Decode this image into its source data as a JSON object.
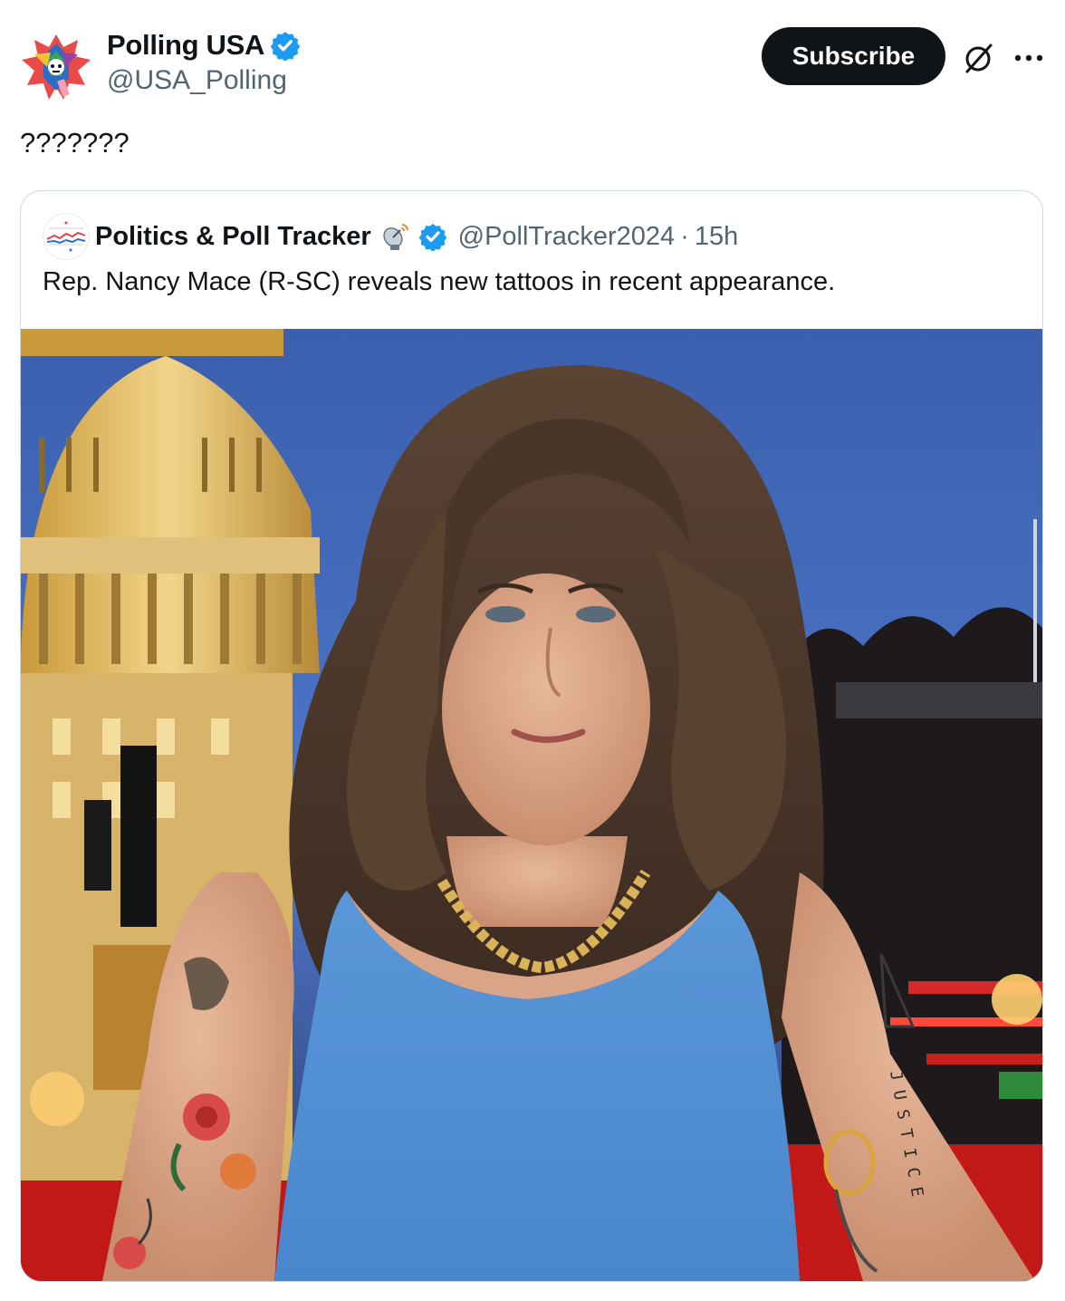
{
  "author": {
    "display_name": "Polling USA",
    "handle": "@USA_Polling",
    "avatar_icon": "polling-usa-logo-icon",
    "verified_icon": "verified-badge-icon"
  },
  "actions": {
    "subscribe_label": "Subscribe",
    "grok_icon": "grok-slash-icon",
    "more_icon": "more-dots-icon"
  },
  "post": {
    "text": "???????"
  },
  "quoted_post": {
    "display_name": "Politics & Poll Tracker",
    "name_emoji_icon": "satellite-antenna-icon",
    "handle": "@PollTracker2024",
    "separator": "·",
    "time": "15h",
    "text": "Rep. Nancy Mace (R-SC) reveals new tattoos in recent appearance.",
    "image": {
      "subject_icon": "photo-woman-blue-top-capitol-background"
    }
  },
  "colors": {
    "text_primary": "#0f1419",
    "text_secondary": "#536471",
    "verified_blue": "#1d9bf0",
    "border": "#cfd9de",
    "button_bg": "#0f1419"
  }
}
